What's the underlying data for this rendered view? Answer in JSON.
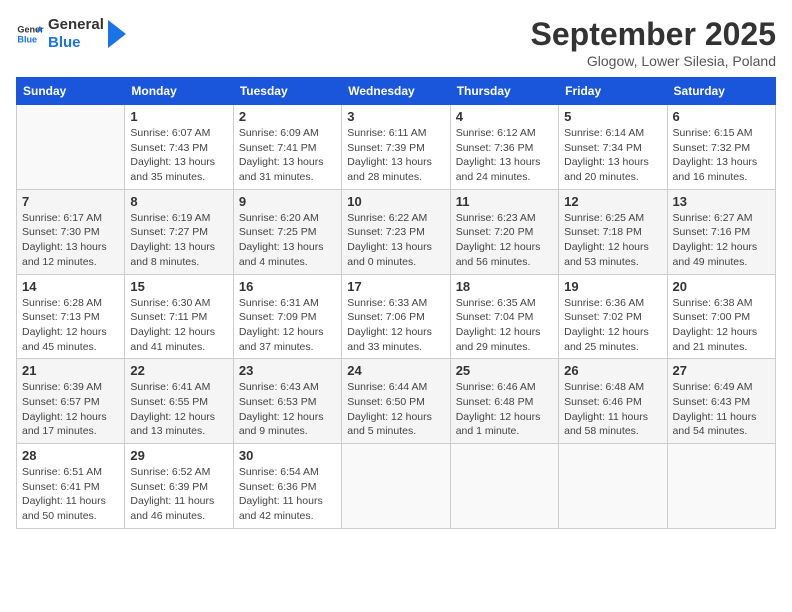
{
  "header": {
    "logo_general": "General",
    "logo_blue": "Blue",
    "month": "September 2025",
    "location": "Glogow, Lower Silesia, Poland"
  },
  "weekdays": [
    "Sunday",
    "Monday",
    "Tuesday",
    "Wednesday",
    "Thursday",
    "Friday",
    "Saturday"
  ],
  "weeks": [
    [
      {
        "day": "",
        "info": ""
      },
      {
        "day": "1",
        "info": "Sunrise: 6:07 AM\nSunset: 7:43 PM\nDaylight: 13 hours\nand 35 minutes."
      },
      {
        "day": "2",
        "info": "Sunrise: 6:09 AM\nSunset: 7:41 PM\nDaylight: 13 hours\nand 31 minutes."
      },
      {
        "day": "3",
        "info": "Sunrise: 6:11 AM\nSunset: 7:39 PM\nDaylight: 13 hours\nand 28 minutes."
      },
      {
        "day": "4",
        "info": "Sunrise: 6:12 AM\nSunset: 7:36 PM\nDaylight: 13 hours\nand 24 minutes."
      },
      {
        "day": "5",
        "info": "Sunrise: 6:14 AM\nSunset: 7:34 PM\nDaylight: 13 hours\nand 20 minutes."
      },
      {
        "day": "6",
        "info": "Sunrise: 6:15 AM\nSunset: 7:32 PM\nDaylight: 13 hours\nand 16 minutes."
      }
    ],
    [
      {
        "day": "7",
        "info": "Sunrise: 6:17 AM\nSunset: 7:30 PM\nDaylight: 13 hours\nand 12 minutes."
      },
      {
        "day": "8",
        "info": "Sunrise: 6:19 AM\nSunset: 7:27 PM\nDaylight: 13 hours\nand 8 minutes."
      },
      {
        "day": "9",
        "info": "Sunrise: 6:20 AM\nSunset: 7:25 PM\nDaylight: 13 hours\nand 4 minutes."
      },
      {
        "day": "10",
        "info": "Sunrise: 6:22 AM\nSunset: 7:23 PM\nDaylight: 13 hours\nand 0 minutes."
      },
      {
        "day": "11",
        "info": "Sunrise: 6:23 AM\nSunset: 7:20 PM\nDaylight: 12 hours\nand 56 minutes."
      },
      {
        "day": "12",
        "info": "Sunrise: 6:25 AM\nSunset: 7:18 PM\nDaylight: 12 hours\nand 53 minutes."
      },
      {
        "day": "13",
        "info": "Sunrise: 6:27 AM\nSunset: 7:16 PM\nDaylight: 12 hours\nand 49 minutes."
      }
    ],
    [
      {
        "day": "14",
        "info": "Sunrise: 6:28 AM\nSunset: 7:13 PM\nDaylight: 12 hours\nand 45 minutes."
      },
      {
        "day": "15",
        "info": "Sunrise: 6:30 AM\nSunset: 7:11 PM\nDaylight: 12 hours\nand 41 minutes."
      },
      {
        "day": "16",
        "info": "Sunrise: 6:31 AM\nSunset: 7:09 PM\nDaylight: 12 hours\nand 37 minutes."
      },
      {
        "day": "17",
        "info": "Sunrise: 6:33 AM\nSunset: 7:06 PM\nDaylight: 12 hours\nand 33 minutes."
      },
      {
        "day": "18",
        "info": "Sunrise: 6:35 AM\nSunset: 7:04 PM\nDaylight: 12 hours\nand 29 minutes."
      },
      {
        "day": "19",
        "info": "Sunrise: 6:36 AM\nSunset: 7:02 PM\nDaylight: 12 hours\nand 25 minutes."
      },
      {
        "day": "20",
        "info": "Sunrise: 6:38 AM\nSunset: 7:00 PM\nDaylight: 12 hours\nand 21 minutes."
      }
    ],
    [
      {
        "day": "21",
        "info": "Sunrise: 6:39 AM\nSunset: 6:57 PM\nDaylight: 12 hours\nand 17 minutes."
      },
      {
        "day": "22",
        "info": "Sunrise: 6:41 AM\nSunset: 6:55 PM\nDaylight: 12 hours\nand 13 minutes."
      },
      {
        "day": "23",
        "info": "Sunrise: 6:43 AM\nSunset: 6:53 PM\nDaylight: 12 hours\nand 9 minutes."
      },
      {
        "day": "24",
        "info": "Sunrise: 6:44 AM\nSunset: 6:50 PM\nDaylight: 12 hours\nand 5 minutes."
      },
      {
        "day": "25",
        "info": "Sunrise: 6:46 AM\nSunset: 6:48 PM\nDaylight: 12 hours\nand 1 minute."
      },
      {
        "day": "26",
        "info": "Sunrise: 6:48 AM\nSunset: 6:46 PM\nDaylight: 11 hours\nand 58 minutes."
      },
      {
        "day": "27",
        "info": "Sunrise: 6:49 AM\nSunset: 6:43 PM\nDaylight: 11 hours\nand 54 minutes."
      }
    ],
    [
      {
        "day": "28",
        "info": "Sunrise: 6:51 AM\nSunset: 6:41 PM\nDaylight: 11 hours\nand 50 minutes."
      },
      {
        "day": "29",
        "info": "Sunrise: 6:52 AM\nSunset: 6:39 PM\nDaylight: 11 hours\nand 46 minutes."
      },
      {
        "day": "30",
        "info": "Sunrise: 6:54 AM\nSunset: 6:36 PM\nDaylight: 11 hours\nand 42 minutes."
      },
      {
        "day": "",
        "info": ""
      },
      {
        "day": "",
        "info": ""
      },
      {
        "day": "",
        "info": ""
      },
      {
        "day": "",
        "info": ""
      }
    ]
  ]
}
